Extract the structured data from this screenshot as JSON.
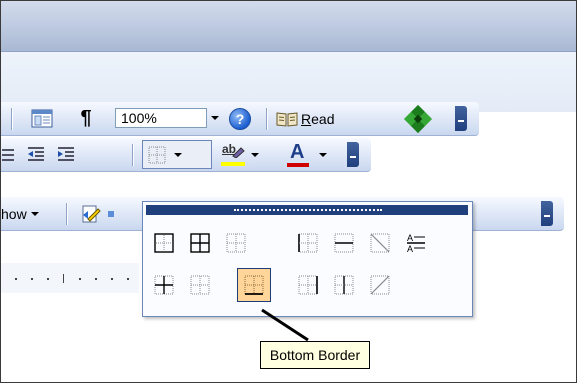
{
  "toolbar_standard": {
    "zoom_value": "100%",
    "read_label": "Read",
    "read_accelerator": "R"
  },
  "toolbar_formatting": {
    "border_button_icon": "all-borders-icon",
    "highlight_label": "ab"
  },
  "toolbar_other": {
    "show_label": "how"
  },
  "border_palette": {
    "cells": [
      "outside-borders-icon",
      "all-borders-icon",
      "inside-borders-icon",
      "left-border-icon",
      "horizontal-border-icon",
      "diagonal-down-icon",
      "horizontal-line-icon",
      "inside-cross-icon",
      "no-border-icon",
      "bottom-border-icon",
      "right-border-icon",
      "inside-vertical-icon",
      "diagonal-up-icon"
    ],
    "hovered": "bottom-border-icon"
  },
  "tooltip": {
    "text": "Bottom Border"
  },
  "colors": {
    "toolbar_top": "#f6f9ff",
    "toolbar_bottom": "#c9d7ef",
    "grip": "#1f3f7d",
    "hover": "#ffd59a",
    "highlight_yellow": "#ffff00",
    "font_red": "#d00000"
  }
}
